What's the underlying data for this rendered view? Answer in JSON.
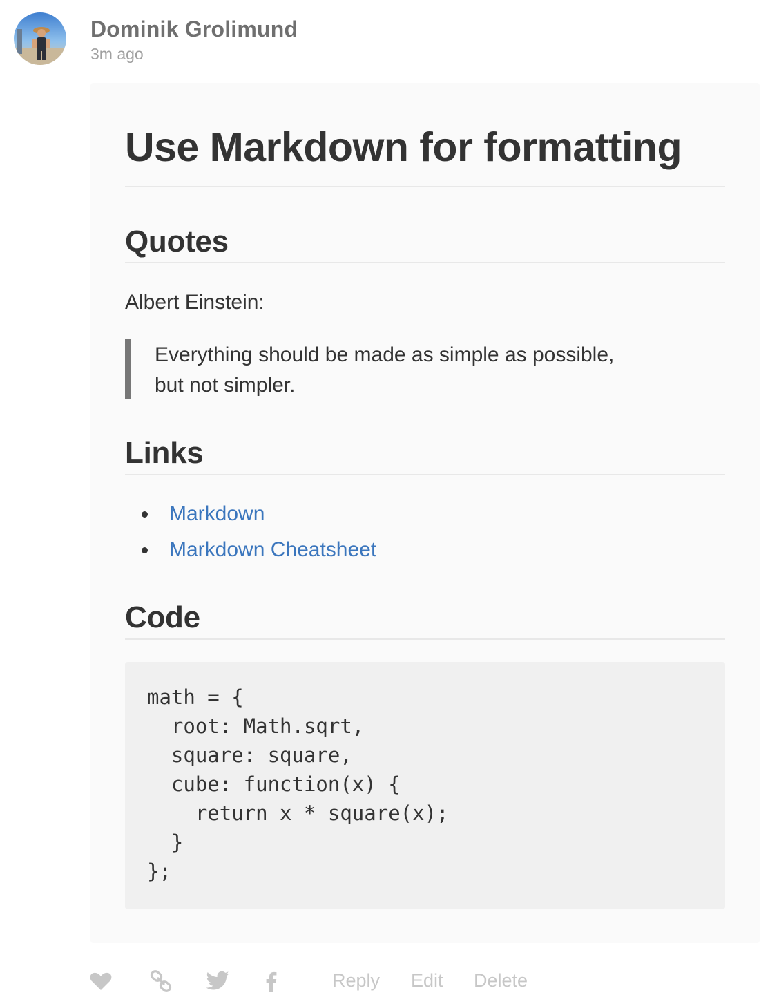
{
  "author": {
    "name": "Dominik Grolimund",
    "time": "3m ago",
    "avatar_icon": "user-avatar-photo"
  },
  "post": {
    "title": "Use Markdown for formatting",
    "sections": {
      "quotes": {
        "heading": "Quotes",
        "intro": "Albert Einstein:",
        "quote_line1": "Everything should be made as simple as possible,",
        "quote_line2": "but not simpler."
      },
      "links": {
        "heading": "Links",
        "items": [
          {
            "label": "Markdown"
          },
          {
            "label": "Markdown Cheatsheet"
          }
        ]
      },
      "code": {
        "heading": "Code",
        "lines": [
          "math = {",
          "  root: Math.sqrt,",
          "  square: square,",
          "  cube: function(x) {",
          "    return x * square(x);",
          "  }",
          "};"
        ]
      }
    }
  },
  "actions": {
    "like_icon": "heart-icon",
    "permalink_icon": "link-icon",
    "twitter_icon": "twitter-icon",
    "facebook_icon": "facebook-icon",
    "reply": "Reply",
    "edit": "Edit",
    "delete": "Delete"
  },
  "colors": {
    "link": "#3b76bd",
    "card_background": "#fafafa",
    "code_background": "#f0f0f0",
    "action_muted": "#c7c7c7",
    "quote_bar": "#777777"
  }
}
